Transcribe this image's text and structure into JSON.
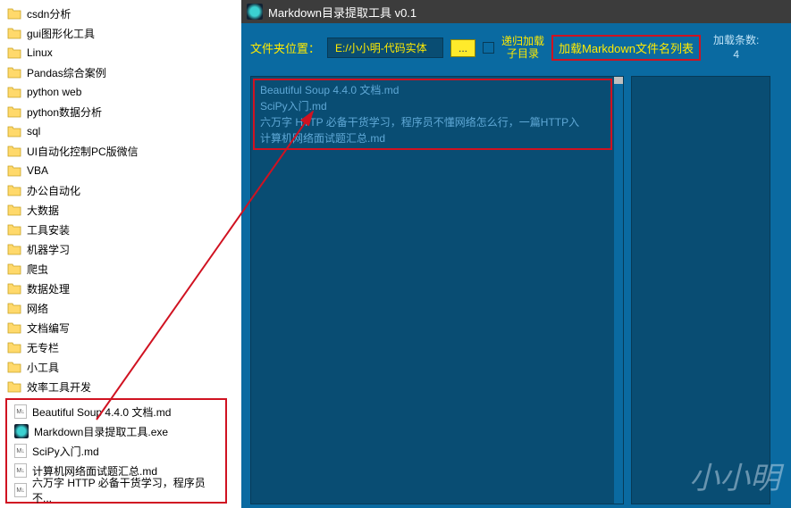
{
  "window": {
    "title": "Markdown目录提取工具 v0.1"
  },
  "folders": [
    "csdn分析",
    "gui图形化工具",
    "Linux",
    "Pandas综合案例",
    "python web",
    "python数据分析",
    "sql",
    "UI自动化控制PC版微信",
    "VBA",
    "办公自动化",
    "大数据",
    "工具安装",
    "机器学习",
    "爬虫",
    "数据处理",
    "网络",
    "文档编写",
    "无专栏",
    "小工具",
    "效率工具开发"
  ],
  "files": [
    {
      "name": "Beautiful Soup 4.4.0 文档.md",
      "type": "md"
    },
    {
      "name": "Markdown目录提取工具.exe",
      "type": "exe"
    },
    {
      "name": "SciPy入门.md",
      "type": "md"
    },
    {
      "name": "计算机网络面试题汇总.md",
      "type": "md"
    },
    {
      "name": "六万字 HTTP 必备干货学习，程序员不...",
      "type": "md"
    }
  ],
  "toolbar": {
    "path_label": "文件夹位置：",
    "path_value": "E:/小小明-代码实体",
    "browse": "...",
    "recurse_label": "递归加载\n子目录",
    "load_label": "加载Markdown文件名列表",
    "count_label": "加载条数:",
    "count_value": "4"
  },
  "loaded_files": [
    "Beautiful Soup 4.4.0 文档.md",
    "SciPy入门.md",
    "六万字 HTTP 必备干货学习，程序员不懂网络怎么行，一篇HTTP入",
    "计算机网络面试题汇总.md"
  ],
  "watermark": "小小明"
}
